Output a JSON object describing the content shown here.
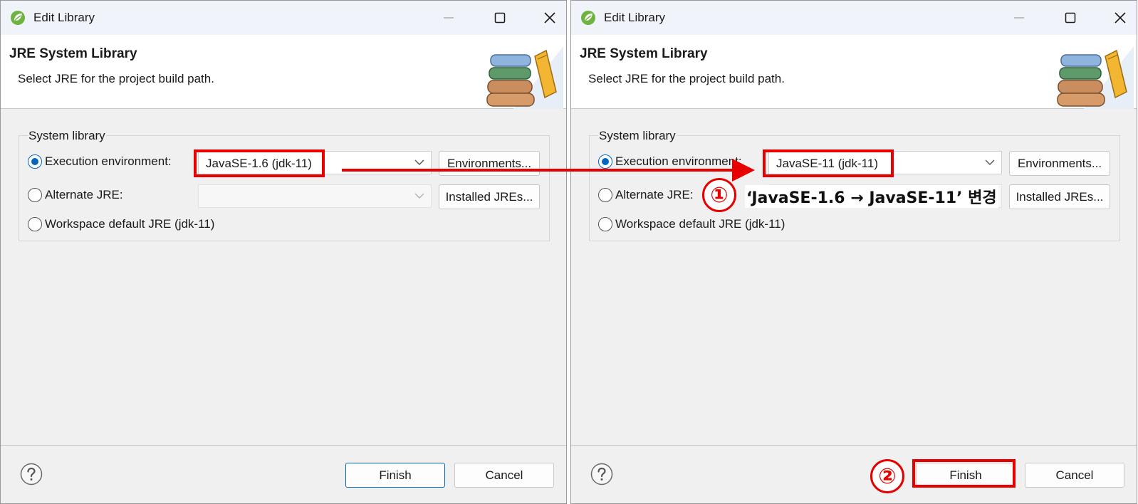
{
  "dialogs": [
    {
      "title": "Edit Library",
      "header_title": "JRE System Library",
      "header_desc": "Select JRE for the project build path.",
      "group_label": "System library",
      "exec_env_label": "Execution environment:",
      "exec_env_value": "JavaSE-1.6 (jdk-11)",
      "environments_btn": "Environments...",
      "alt_jre_label": "Alternate JRE:",
      "installed_jres_btn": "Installed JREs...",
      "workspace_default_label": "Workspace default JRE (jdk-11)",
      "finish_btn": "Finish",
      "cancel_btn": "Cancel"
    },
    {
      "title": "Edit Library",
      "header_title": "JRE System Library",
      "header_desc": "Select JRE for the project build path.",
      "group_label": "System library",
      "exec_env_label": "Execution environment:",
      "exec_env_value": "JavaSE-11 (jdk-11)",
      "environments_btn": "Environments...",
      "alt_jre_label": "Alternate JRE:",
      "installed_jres_btn": "Installed JREs...",
      "workspace_default_label": "Workspace default JRE (jdk-11)",
      "finish_btn": "Finish",
      "cancel_btn": "Cancel"
    }
  ],
  "annotations": {
    "step1_number": "①",
    "step1_text": "‘JavaSE-1.6 → JavaSE-11’ 변경",
    "step2_number": "②"
  },
  "icons": {
    "app": "spring-leaf-icon",
    "minimize": "minimize-icon",
    "maximize": "maximize-icon",
    "close": "close-icon",
    "books": "library-books-icon",
    "help": "help-icon",
    "dropdown": "chevron-down-icon"
  },
  "colors": {
    "annotation_red": "#e60000",
    "accent_blue": "#0067c0",
    "spring_green": "#6db33f"
  }
}
